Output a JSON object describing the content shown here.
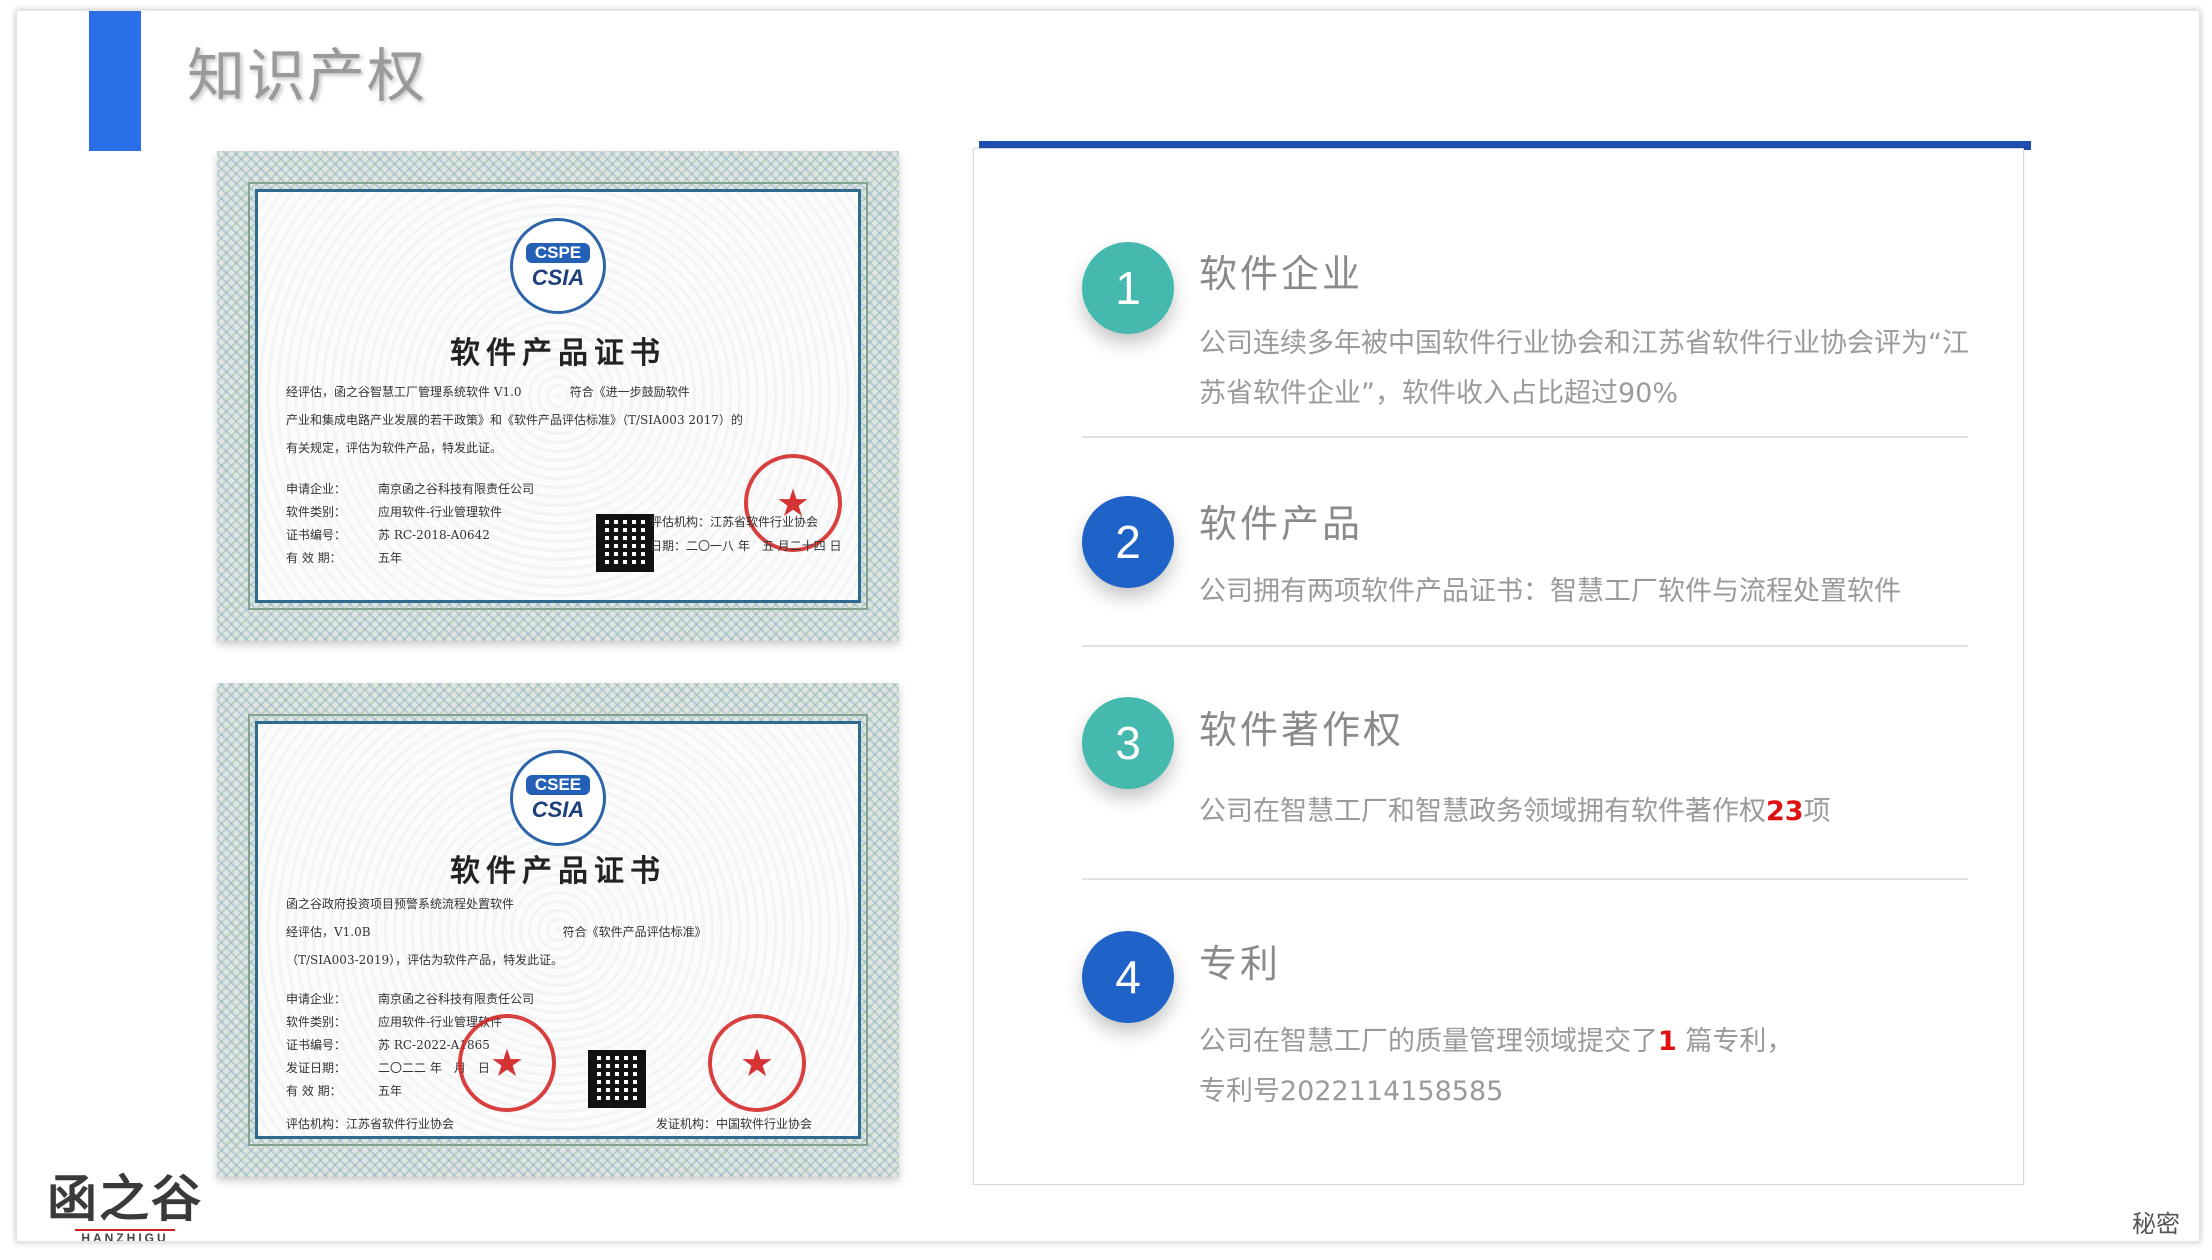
{
  "page": {
    "title": "知识产权",
    "accent_color": "#2a6ee8",
    "panel_bar_color": "#1f4fae"
  },
  "certificates": [
    {
      "logo_top": "CSPE",
      "logo_bottom": "CSIA",
      "title": "软件产品证书",
      "body_line1": "经评估，函之谷智慧工厂管理系统软件 V1.0　　　　符合《进一步鼓励软件",
      "body_line2": "产业和集成电路产业发展的若干政策》和《软件产品评估标准》（T/SIA003  2017）的",
      "body_line3": "有关规定，评估为软件产品，特发此证。",
      "fields": [
        {
          "label": "申请企业：",
          "value": "南京函之谷科技有限责任公司"
        },
        {
          "label": "软件类别：",
          "value": "应用软件-行业管理软件"
        },
        {
          "label": "证书编号：",
          "value": "苏 RC-2018-A0642"
        },
        {
          "label": "有 效 期：",
          "value": "五年"
        }
      ],
      "issuer_line1": "评估机构：江苏省软件行业协会",
      "issuer_line2": "日期：二〇一八 年　五 月二十四 日"
    },
    {
      "logo_top": "CSEE",
      "logo_bottom": "CSIA",
      "title": "软件产品证书",
      "body_line1": "函之谷政府投资项目预警系统流程处置软件",
      "body_line2": "经评估，V1.0B　　　　　　　　　　　　　　　　符合《软件产品评估标准》",
      "body_line3": "（T/SIA003-2019），评估为软件产品，特发此证。",
      "fields": [
        {
          "label": "申请企业：",
          "value": "南京函之谷科技有限责任公司"
        },
        {
          "label": "软件类别：",
          "value": "应用软件-行业管理软件"
        },
        {
          "label": "证书编号：",
          "value": "苏 RC-2022-A1865"
        },
        {
          "label": "发证日期：",
          "value": "二〇二二 年　月　日"
        },
        {
          "label": "有 效 期：",
          "value": "五年"
        }
      ],
      "issuer_a": "评估机构：江苏省软件行业协会",
      "issuer_b": "发证机构：中国软件行业协会"
    }
  ],
  "items": [
    {
      "number": "1",
      "color": "#45b9ad",
      "title": "软件企业",
      "desc_line1": "公司连续多年被中国软件行业协会和江苏省软件行业协会评为“江",
      "desc_line2": "苏省软件企业”，软件收入占比超过90%"
    },
    {
      "number": "2",
      "color": "#1f62c8",
      "title": "软件产品",
      "desc_line1": "公司拥有两项软件产品证书：智慧工厂软件与流程处置软件"
    },
    {
      "number": "3",
      "color": "#45b9ad",
      "title": "软件著作权",
      "desc_before": "公司在智慧工厂和智慧政务领域拥有软件著作权",
      "desc_highlight": "23",
      "desc_after": "项"
    },
    {
      "number": "4",
      "color": "#1f62c8",
      "title": "专利",
      "desc_before": "公司在智慧工厂的质量管理领域提交了",
      "desc_highlight": "1",
      "desc_after": "  篇专利，",
      "desc_line2": "专利号2022114158585"
    }
  ],
  "footer": {
    "brand_name": "函之谷",
    "brand_sub": "HANZHIGU",
    "confidential": "秘密"
  }
}
